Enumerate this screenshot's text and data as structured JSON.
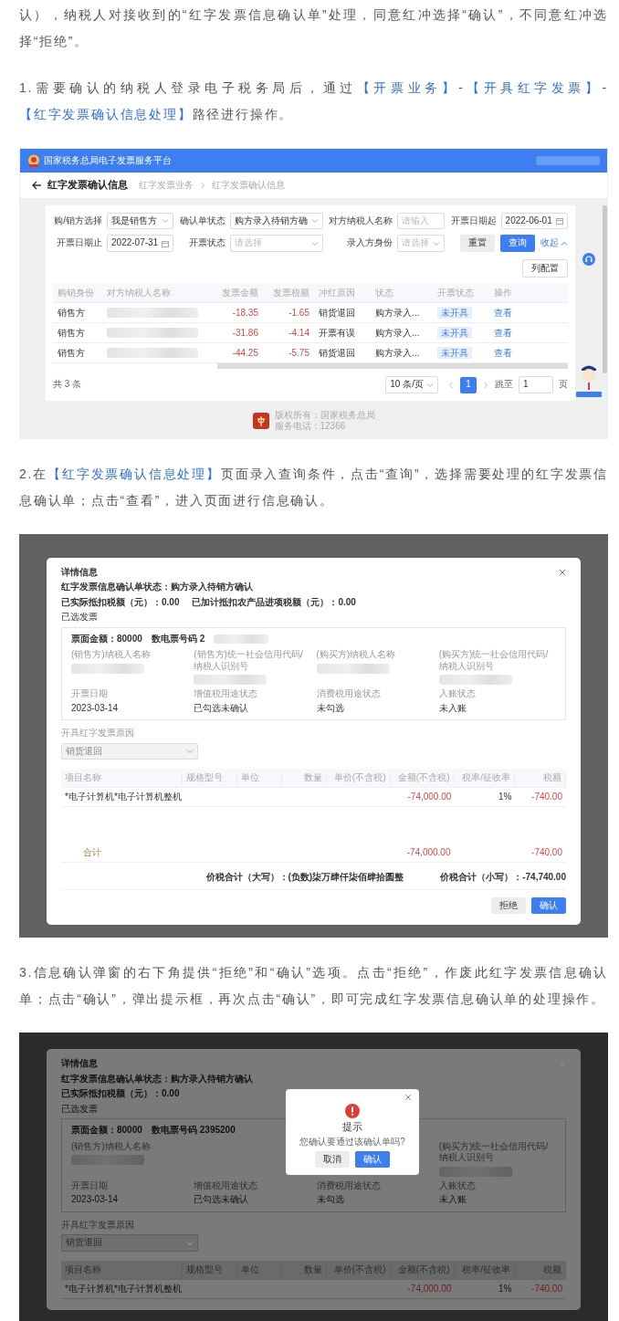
{
  "intro": {
    "segments": [
      {
        "text": "认），纳税人对接收到的“红字发票信息确认单”处理，同意红冲选择“确认”，不同意红冲选择“拒绝”。",
        "kind": "plain"
      }
    ]
  },
  "step_1": {
    "segments": [
      {
        "text": "1.需要确认的纳税人登录电子税务局后，通过",
        "kind": "plain"
      },
      {
        "text": "【开票业务】",
        "kind": "link"
      },
      {
        "text": "-",
        "kind": "plain"
      },
      {
        "text": "【开具红字发票】",
        "kind": "link"
      },
      {
        "text": "-",
        "kind": "plain"
      },
      {
        "text": "【红字发票确认信息处理】",
        "kind": "link"
      },
      {
        "text": "路径进行操作。",
        "kind": "plain"
      }
    ]
  },
  "screenshot_1": {
    "header": {
      "title": "国家税务总局电子发票服务平台"
    },
    "page_title": "红字发票确认信息",
    "breadcrumb": [
      "红字发票业务",
      "红字发票确认信息"
    ],
    "filters": [
      {
        "label": "购/销方选择",
        "kind": "select",
        "value": "我是销售方"
      },
      {
        "label": "确认单状态",
        "kind": "select",
        "value": "购方录入待销方确"
      },
      {
        "label": "对方纳税人名称",
        "kind": "input",
        "placeholder": "请输入"
      },
      {
        "label": "开票日期起",
        "kind": "date",
        "value": "2022-06-01"
      },
      {
        "label": "开票日期止",
        "kind": "date",
        "value": "2022-07-31"
      },
      {
        "label": "开票状态",
        "kind": "select",
        "placeholder": "请选择"
      },
      {
        "label": "录入方身份",
        "kind": "select",
        "placeholder": "请选择"
      }
    ],
    "actions": [
      {
        "label": "重置",
        "kind": "default"
      },
      {
        "label": "查询",
        "kind": "primary"
      },
      {
        "label": "收起",
        "kind": "link"
      }
    ],
    "column_settings": "列配置",
    "table": {
      "columns": [
        "购销身份",
        "对方纳税人名称",
        "发票金额",
        "发票税额",
        "冲红原因",
        "状态",
        "开票状态",
        "操作"
      ],
      "rows": [
        {
          "role": "销售方",
          "amount": "-18.35",
          "tax": "-1.65",
          "reason": "销货退回",
          "status": "购方录入...",
          "issue_status": "未开具",
          "action": "查看"
        },
        {
          "role": "销售方",
          "amount": "-31.86",
          "tax": "-4.14",
          "reason": "开票有误",
          "status": "购方录入...",
          "issue_status": "未开具",
          "action": "查看"
        },
        {
          "role": "销售方",
          "amount": "-44.25",
          "tax": "-5.75",
          "reason": "销货退回",
          "status": "购方录入...",
          "issue_status": "未开具",
          "action": "查看"
        }
      ]
    },
    "pagination": {
      "total": "共 3 条",
      "page_size": "10 条/页",
      "pages": [
        {
          "label": "1",
          "selected": true
        }
      ],
      "jump_label": "跳至",
      "jump_value": "1",
      "jump_suffix": "页"
    },
    "footer": {
      "lines": [
        "版权所有：国家税务总局",
        "服务电话：12366"
      ]
    }
  },
  "step_2": {
    "segments": [
      {
        "text": "2.在",
        "kind": "plain"
      },
      {
        "text": "【红字发票确认信息处理】",
        "kind": "link"
      },
      {
        "text": "页面录入查询条件，点击“查询”，选择需要处理的红字发票信息确认单；点击“查看”，进入页面进行信息确认。",
        "kind": "plain"
      }
    ]
  },
  "screenshot_2": {
    "modal": {
      "title": "详情信息",
      "status": "红字发票信息确认单状态：购方录入待销方确认",
      "deductions": [
        "已实际抵扣税额（元）：0.00",
        "已加计抵扣农产品进项税额（元）：0.00"
      ],
      "section_title": "已选发票",
      "invoice": {
        "amount": "票面金额：80000",
        "number_label": "数电票号码",
        "number_value": "2",
        "number_redacted": true,
        "fields": [
          {
            "label": "(销售方)纳税人名称",
            "kind": "redacted"
          },
          {
            "label": "(销售方)统一社会信用代码/纳税人识别号",
            "kind": "redacted"
          },
          {
            "label": "(购买方)纳税人名称",
            "kind": "redacted"
          },
          {
            "label": "(购买方)统一社会信用代码/纳税人识别号",
            "kind": "redacted"
          },
          {
            "label": "开票日期",
            "kind": "text",
            "value": "2023-03-14"
          },
          {
            "label": "增值税用途状态",
            "kind": "text",
            "value": "已勾选未确认"
          },
          {
            "label": "消费税用途状态",
            "kind": "text",
            "value": "未勾选"
          },
          {
            "label": "入账状态",
            "kind": "text",
            "value": "未入账"
          }
        ]
      },
      "reason": {
        "label": "开具红字发票原因",
        "value": "销货退回",
        "disabled": true
      },
      "items": {
        "columns": [
          "项目名称",
          "规格型号",
          "单位",
          "数量",
          "单价(不含税)",
          "金额(不含税)",
          "税率/征收率",
          "税额"
        ],
        "rows": [
          {
            "name": "*电子计算机*电子计算机整机",
            "amount": "-74,000.00",
            "rate": "1%",
            "tax": "-740.00"
          }
        ],
        "total": {
          "label": "合计",
          "amount": "-74,000.00",
          "tax": "-740.00"
        }
      },
      "summary": [
        "价税合计（大写）：(负数)柒万肆仟柒佰肆拾圆整",
        "价税合计（小写）：-74,740.00"
      ],
      "buttons": [
        {
          "label": "拒绝",
          "kind": "default"
        },
        {
          "label": "确认",
          "kind": "primary"
        }
      ]
    }
  },
  "step_3": {
    "segments": [
      {
        "text": "3.信息确认弹窗的右下角提供“拒绝”和“确认”选项。点击“拒绝”，作废此红字发票信息确认单；点击“确认”，弹出提示框，再次点击“确认”，即可完成红字发票信息确认单的处理操作。",
        "kind": "plain"
      }
    ]
  },
  "screenshot_3": {
    "modal": {
      "title": "详情信息",
      "status": "红字发票信息确认单状态：购方录入待销方确认",
      "deductions": [
        "已实际抵扣税额（元）：0.00"
      ],
      "section_title": "已选发票",
      "invoice": {
        "amount": "票面金额：80000",
        "number_label": "数电票号码",
        "number_value": "2395200",
        "number_redacted": false,
        "fields": [
          {
            "label": "(销售方)纳税人名称",
            "kind": "redacted"
          },
          {
            "kind": "covered"
          },
          {
            "kind": "covered"
          },
          {
            "label": "(购买方)统一社会信用代码/纳税人识别号",
            "kind": "redacted"
          },
          {
            "label": "开票日期",
            "kind": "text",
            "value": "2023-03-14"
          },
          {
            "label": "增值税用途状态",
            "kind": "text",
            "value": "已勾选未确认"
          },
          {
            "label": "消费税用途状态",
            "kind": "text",
            "value": "未勾选"
          },
          {
            "label": "入账状态",
            "kind": "text",
            "value": "未入账"
          }
        ]
      },
      "reason": {
        "label": "开具红字发票原因",
        "value": "销货退回",
        "disabled": true
      },
      "items": {
        "columns": [
          "项目名称",
          "规格型号",
          "单位",
          "数量",
          "单价(不含税)",
          "金额(不含税)",
          "税率/征收率",
          "税额"
        ],
        "rows": [
          {
            "name": "*电子计算机*电子计算机整机",
            "amount": "-74,000.00",
            "rate": "1%",
            "tax": "-740.00"
          }
        ]
      }
    },
    "dialog": {
      "title": "提示",
      "message": "您确认要通过该确认单吗?",
      "buttons": [
        {
          "label": "取消",
          "kind": "default"
        },
        {
          "label": "确认",
          "kind": "primary"
        }
      ]
    }
  }
}
